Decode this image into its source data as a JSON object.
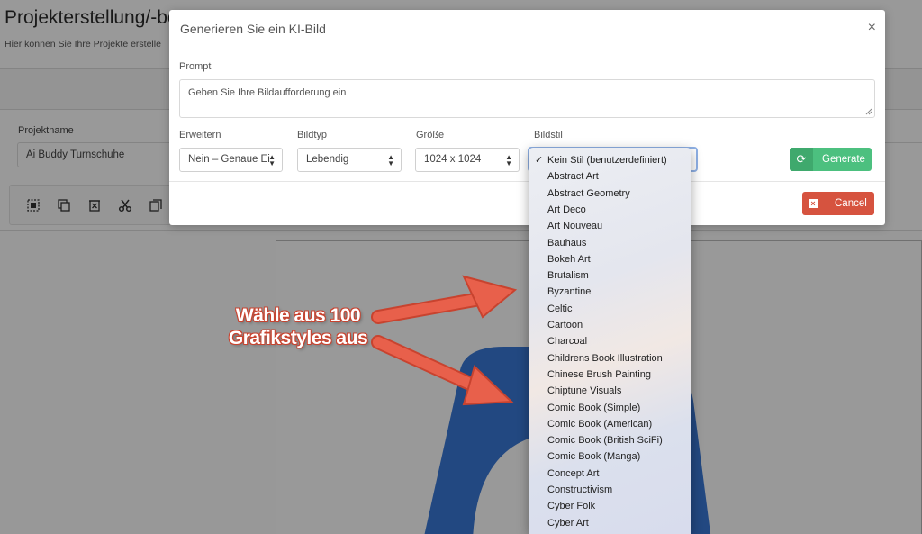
{
  "background": {
    "title": "Projekterstellung/-be",
    "subtitle": "Hier können Sie Ihre Projekte erstelle",
    "project_name_label": "Projektname",
    "project_name_value": "Ai Buddy Turnschuhe",
    "toolbar_icons": [
      "select-all-icon",
      "duplicate-icon",
      "delete-icon",
      "cut-icon",
      "copy-icon"
    ]
  },
  "modal": {
    "title": "Generieren Sie ein KI-Bild",
    "close": "×",
    "prompt_label": "Prompt",
    "prompt_placeholder": "Geben Sie Ihre Bildaufforderung ein",
    "erweitern_label": "Erweitern",
    "erweitern_value": "Nein – Genaue Ei",
    "bildtyp_label": "Bildtyp",
    "bildtyp_value": "Lebendig",
    "groesse_label": "Größe",
    "groesse_value": "1024 x 1024",
    "bildstil_label": "Bildstil",
    "generate_label": "Generate",
    "cancel_label": "Cancel",
    "colors": {
      "generate": "#4cc07f",
      "cancel": "#d6533f",
      "annotation": "#e0523f"
    }
  },
  "bildstil_options": [
    "Kein Stil (benutzerdefiniert)",
    "Abstract Art",
    "Abstract Geometry",
    "Art Deco",
    "Art Nouveau",
    "Bauhaus",
    "Bokeh Art",
    "Brutalism",
    "Byzantine",
    "Celtic",
    "Cartoon",
    "Charcoal",
    "Childrens Book Illustration",
    "Chinese Brush Painting",
    "Chiptune Visuals",
    "Comic Book (Simple)",
    "Comic Book (American)",
    "Comic Book (British SciFi)",
    "Comic Book (Manga)",
    "Concept Art",
    "Constructivism",
    "Cyber Folk",
    "Cyber Art"
  ],
  "annotation": {
    "line1": "Wähle aus 100",
    "line2": "Grafikstyles aus"
  }
}
